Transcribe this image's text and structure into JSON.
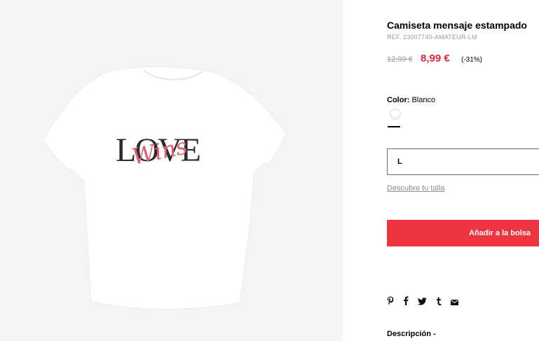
{
  "product": {
    "title": "Camiseta mensaje estampado",
    "ref": "REF. 23007740-AMATEUR-LM",
    "old_price": "12,99 €",
    "price": "8,99 €",
    "discount": "(-31%)",
    "image": {
      "print_word": "LOVE",
      "print_script": "Wins"
    }
  },
  "color": {
    "label": "Color:",
    "value": "Blanco",
    "swatch_color": "#ffffff"
  },
  "size": {
    "selected": "L",
    "guide_link": "Descubre tu talla"
  },
  "actions": {
    "add_to_bag": "Añadir a la bolsa"
  },
  "share": {
    "icons": [
      "pinterest-icon",
      "facebook-icon",
      "twitter-icon",
      "tumblr-icon",
      "email-icon"
    ]
  },
  "description": {
    "label": "Descripción -"
  },
  "colors": {
    "accent": "#ee3340",
    "price": "#e0283f",
    "muted": "#9a9a9a"
  }
}
